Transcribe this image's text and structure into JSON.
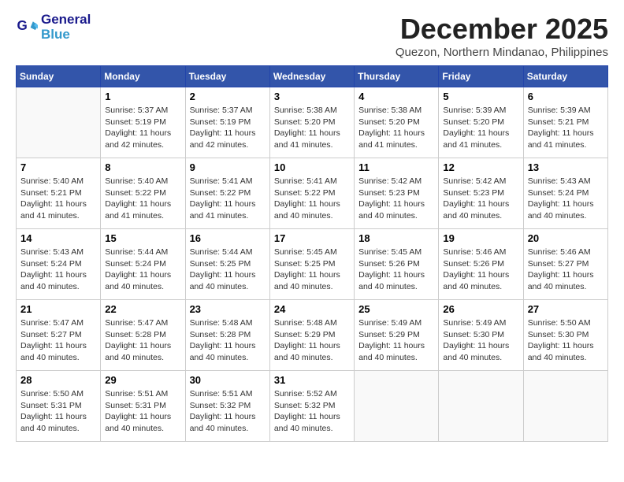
{
  "logo": {
    "line1": "General",
    "line2": "Blue"
  },
  "title": "December 2025",
  "location": "Quezon, Northern Mindanao, Philippines",
  "days_of_week": [
    "Sunday",
    "Monday",
    "Tuesday",
    "Wednesday",
    "Thursday",
    "Friday",
    "Saturday"
  ],
  "weeks": [
    [
      {
        "day": "",
        "info": ""
      },
      {
        "day": "1",
        "info": "Sunrise: 5:37 AM\nSunset: 5:19 PM\nDaylight: 11 hours\nand 42 minutes."
      },
      {
        "day": "2",
        "info": "Sunrise: 5:37 AM\nSunset: 5:19 PM\nDaylight: 11 hours\nand 42 minutes."
      },
      {
        "day": "3",
        "info": "Sunrise: 5:38 AM\nSunset: 5:20 PM\nDaylight: 11 hours\nand 41 minutes."
      },
      {
        "day": "4",
        "info": "Sunrise: 5:38 AM\nSunset: 5:20 PM\nDaylight: 11 hours\nand 41 minutes."
      },
      {
        "day": "5",
        "info": "Sunrise: 5:39 AM\nSunset: 5:20 PM\nDaylight: 11 hours\nand 41 minutes."
      },
      {
        "day": "6",
        "info": "Sunrise: 5:39 AM\nSunset: 5:21 PM\nDaylight: 11 hours\nand 41 minutes."
      }
    ],
    [
      {
        "day": "7",
        "info": "Sunrise: 5:40 AM\nSunset: 5:21 PM\nDaylight: 11 hours\nand 41 minutes."
      },
      {
        "day": "8",
        "info": "Sunrise: 5:40 AM\nSunset: 5:22 PM\nDaylight: 11 hours\nand 41 minutes."
      },
      {
        "day": "9",
        "info": "Sunrise: 5:41 AM\nSunset: 5:22 PM\nDaylight: 11 hours\nand 41 minutes."
      },
      {
        "day": "10",
        "info": "Sunrise: 5:41 AM\nSunset: 5:22 PM\nDaylight: 11 hours\nand 40 minutes."
      },
      {
        "day": "11",
        "info": "Sunrise: 5:42 AM\nSunset: 5:23 PM\nDaylight: 11 hours\nand 40 minutes."
      },
      {
        "day": "12",
        "info": "Sunrise: 5:42 AM\nSunset: 5:23 PM\nDaylight: 11 hours\nand 40 minutes."
      },
      {
        "day": "13",
        "info": "Sunrise: 5:43 AM\nSunset: 5:24 PM\nDaylight: 11 hours\nand 40 minutes."
      }
    ],
    [
      {
        "day": "14",
        "info": "Sunrise: 5:43 AM\nSunset: 5:24 PM\nDaylight: 11 hours\nand 40 minutes."
      },
      {
        "day": "15",
        "info": "Sunrise: 5:44 AM\nSunset: 5:24 PM\nDaylight: 11 hours\nand 40 minutes."
      },
      {
        "day": "16",
        "info": "Sunrise: 5:44 AM\nSunset: 5:25 PM\nDaylight: 11 hours\nand 40 minutes."
      },
      {
        "day": "17",
        "info": "Sunrise: 5:45 AM\nSunset: 5:25 PM\nDaylight: 11 hours\nand 40 minutes."
      },
      {
        "day": "18",
        "info": "Sunrise: 5:45 AM\nSunset: 5:26 PM\nDaylight: 11 hours\nand 40 minutes."
      },
      {
        "day": "19",
        "info": "Sunrise: 5:46 AM\nSunset: 5:26 PM\nDaylight: 11 hours\nand 40 minutes."
      },
      {
        "day": "20",
        "info": "Sunrise: 5:46 AM\nSunset: 5:27 PM\nDaylight: 11 hours\nand 40 minutes."
      }
    ],
    [
      {
        "day": "21",
        "info": "Sunrise: 5:47 AM\nSunset: 5:27 PM\nDaylight: 11 hours\nand 40 minutes."
      },
      {
        "day": "22",
        "info": "Sunrise: 5:47 AM\nSunset: 5:28 PM\nDaylight: 11 hours\nand 40 minutes."
      },
      {
        "day": "23",
        "info": "Sunrise: 5:48 AM\nSunset: 5:28 PM\nDaylight: 11 hours\nand 40 minutes."
      },
      {
        "day": "24",
        "info": "Sunrise: 5:48 AM\nSunset: 5:29 PM\nDaylight: 11 hours\nand 40 minutes."
      },
      {
        "day": "25",
        "info": "Sunrise: 5:49 AM\nSunset: 5:29 PM\nDaylight: 11 hours\nand 40 minutes."
      },
      {
        "day": "26",
        "info": "Sunrise: 5:49 AM\nSunset: 5:30 PM\nDaylight: 11 hours\nand 40 minutes."
      },
      {
        "day": "27",
        "info": "Sunrise: 5:50 AM\nSunset: 5:30 PM\nDaylight: 11 hours\nand 40 minutes."
      }
    ],
    [
      {
        "day": "28",
        "info": "Sunrise: 5:50 AM\nSunset: 5:31 PM\nDaylight: 11 hours\nand 40 minutes."
      },
      {
        "day": "29",
        "info": "Sunrise: 5:51 AM\nSunset: 5:31 PM\nDaylight: 11 hours\nand 40 minutes."
      },
      {
        "day": "30",
        "info": "Sunrise: 5:51 AM\nSunset: 5:32 PM\nDaylight: 11 hours\nand 40 minutes."
      },
      {
        "day": "31",
        "info": "Sunrise: 5:52 AM\nSunset: 5:32 PM\nDaylight: 11 hours\nand 40 minutes."
      },
      {
        "day": "",
        "info": ""
      },
      {
        "day": "",
        "info": ""
      },
      {
        "day": "",
        "info": ""
      }
    ]
  ]
}
